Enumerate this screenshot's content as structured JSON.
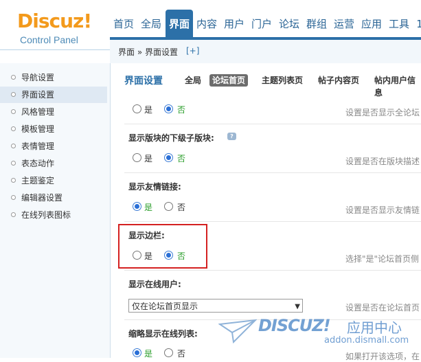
{
  "logo": {
    "word": "Discuz!",
    "subtitle": "Control Panel"
  },
  "nav": {
    "items": [
      {
        "label": "首页"
      },
      {
        "label": "全局"
      },
      {
        "label": "界面"
      },
      {
        "label": "内容"
      },
      {
        "label": "用户"
      },
      {
        "label": "门户"
      },
      {
        "label": "论坛"
      },
      {
        "label": "群组"
      },
      {
        "label": "运营"
      },
      {
        "label": "应用"
      },
      {
        "label": "工具"
      },
      {
        "label": "1"
      }
    ],
    "active": "界面"
  },
  "breadcrumb": {
    "path": "界面 » 界面设置",
    "add": "[+]"
  },
  "sidebar": {
    "items": [
      {
        "label": "导航设置"
      },
      {
        "label": "界面设置"
      },
      {
        "label": "风格管理"
      },
      {
        "label": "模板管理"
      },
      {
        "label": "表情管理"
      },
      {
        "label": "表态动作"
      },
      {
        "label": "主题鉴定"
      },
      {
        "label": "编辑器设置"
      },
      {
        "label": "在线列表图标"
      }
    ],
    "active": "界面设置"
  },
  "tabs": {
    "title": "界面设置",
    "items": [
      {
        "label": "全局"
      },
      {
        "label": "论坛首页"
      },
      {
        "label": "主题列表页"
      },
      {
        "label": "帖子内容页"
      },
      {
        "label": "帖内用户信息"
      }
    ],
    "active": "论坛首页"
  },
  "settings": {
    "row0": {
      "yes": "是",
      "no": "否",
      "selected": "no",
      "desc": "设置是否显示全论坛"
    },
    "row1": {
      "title": "显示版块的下级子版块:",
      "help": "?",
      "yes": "是",
      "no": "否",
      "selected": "no",
      "desc": "设置是否在版块描述"
    },
    "row2": {
      "title": "显示友情链接:",
      "yes": "是",
      "no": "否",
      "selected": "yes",
      "desc": "设置是否显示友情链"
    },
    "row3": {
      "title": "显示边栏:",
      "yes": "是",
      "no": "否",
      "selected": "no",
      "desc": "选择\"是\"论坛首页侧"
    },
    "row4": {
      "title": "显示在线用户:",
      "select_value": "仅在论坛首页显示",
      "desc": "设置是否在论坛首页"
    },
    "row5": {
      "title": "缩略显示在线列表:",
      "yes": "是",
      "no": "否",
      "selected": "yes",
      "desc": "如果打开该选项，在"
    }
  },
  "watermark": {
    "word": "DISCUZ!",
    "cn": "应用中心",
    "url": "addon.dismall.com"
  },
  "colors": {
    "accent": "#2c70a8",
    "logo": "#f39a1c",
    "highlight": "#d42020",
    "yes_green": "#2a9d2a"
  }
}
